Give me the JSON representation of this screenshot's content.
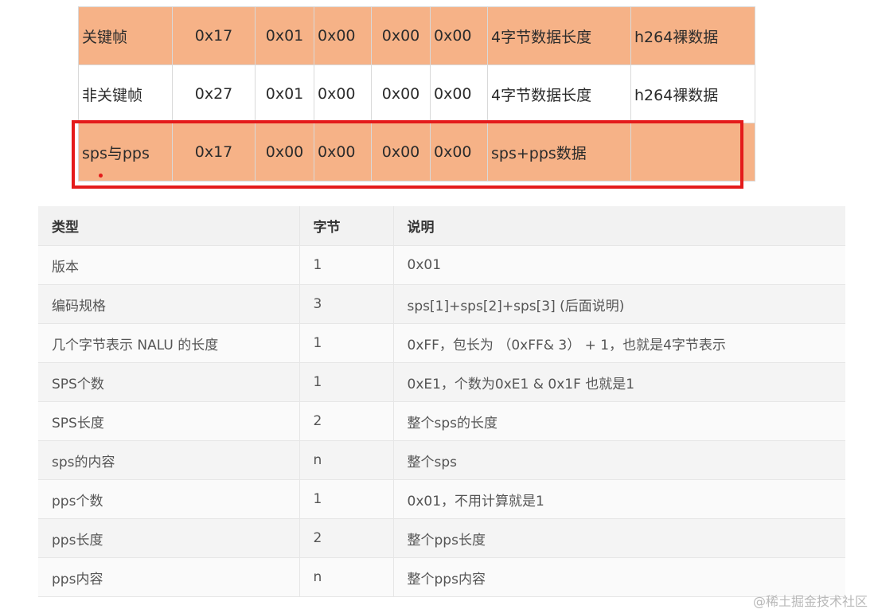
{
  "top_table": {
    "rows": [
      {
        "style": "orange",
        "cells": [
          "关键帧",
          "0x17",
          "0x01",
          "0x00",
          "0x00",
          "0x00",
          "4字节数据长度",
          "h264裸数据"
        ]
      },
      {
        "style": "white",
        "cells": [
          "非关键帧",
          "0x27",
          "0x01",
          "0x00",
          "0x00",
          "0x00",
          "4字节数据长度",
          "h264裸数据"
        ]
      },
      {
        "style": "orange",
        "cells": [
          "sps与pps",
          "0x17",
          "0x00",
          "0x00",
          "0x00",
          "0x00",
          "sps+pps数据",
          ""
        ]
      }
    ]
  },
  "info_table": {
    "headers": [
      "类型",
      "字节",
      "说明"
    ],
    "rows": [
      [
        "版本",
        "1",
        "0x01"
      ],
      [
        "编码规格",
        "3",
        "sps[1]+sps[2]+sps[3] (后面说明)"
      ],
      [
        "几个字节表示 NALU 的长度",
        "1",
        "0xFF，包长为 （0xFF& 3） + 1，也就是4字节表示"
      ],
      [
        "SPS个数",
        "1",
        "0xE1，个数为0xE1 & 0x1F 也就是1"
      ],
      [
        "SPS长度",
        "2",
        "整个sps的长度"
      ],
      [
        "sps的内容",
        "n",
        "整个sps"
      ],
      [
        "pps个数",
        "1",
        "0x01，不用计算就是1"
      ],
      [
        "pps长度",
        "2",
        "整个pps长度"
      ],
      [
        "pps内容",
        "n",
        "整个pps内容"
      ]
    ]
  },
  "watermark": "@稀土掘金技术社区",
  "colors": {
    "orange_fill": "#f6b287",
    "highlight": "#e41b1b"
  }
}
